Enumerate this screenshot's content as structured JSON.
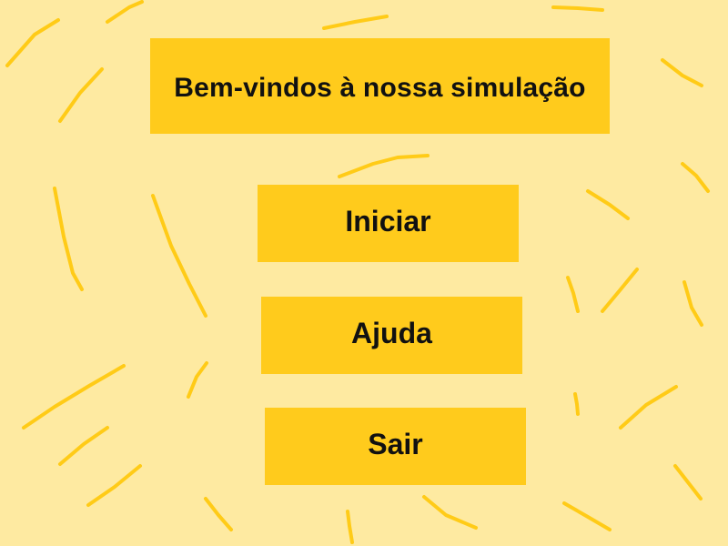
{
  "screen": {
    "title": "Bem-vindos à nossa simulação"
  },
  "menu": {
    "start_label": "Iniciar",
    "help_label": "Ajuda",
    "exit_label": "Sair"
  },
  "colors": {
    "background": "#FEEAA1",
    "panel": "#FFCB1C",
    "squiggle": "#FFCB17",
    "text": "#111111"
  }
}
